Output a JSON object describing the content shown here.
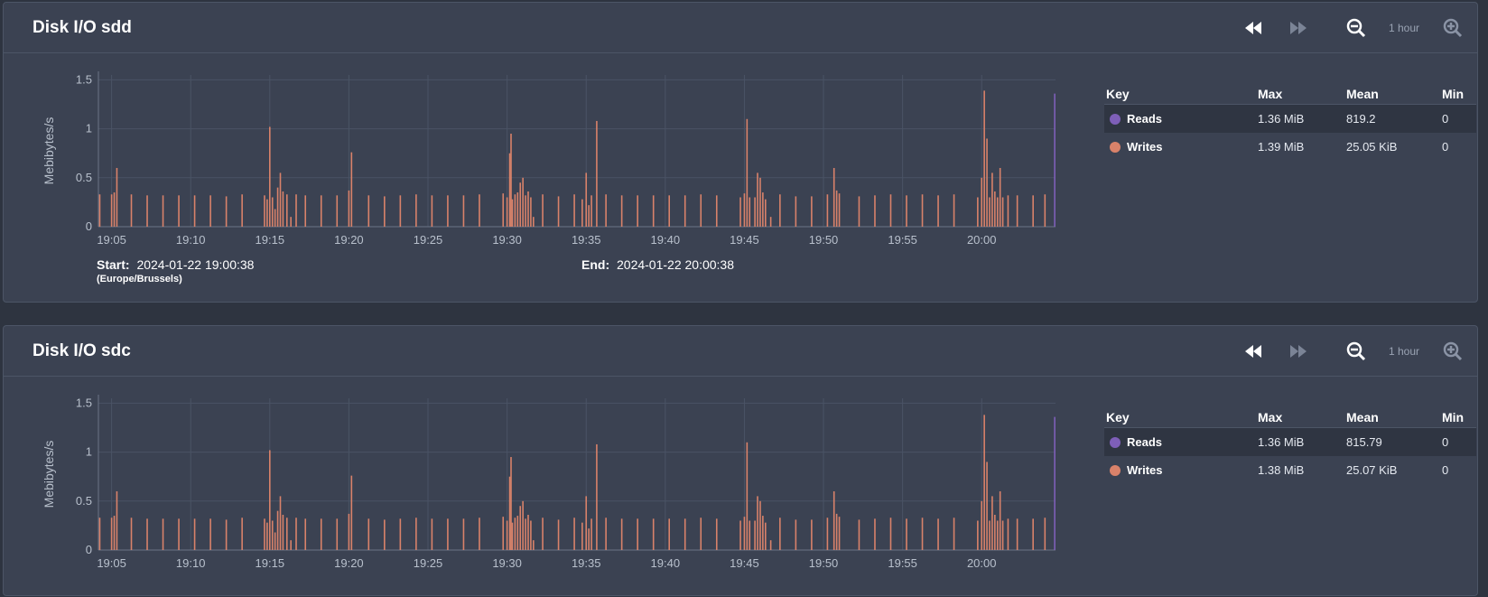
{
  "colors": {
    "reads": "#7e5fb8",
    "writes": "#d9826a"
  },
  "controls": {
    "range_label": "1 hour"
  },
  "panels": [
    {
      "title": "Disk I/O sdd",
      "legend": {
        "headers": {
          "key": "Key",
          "max": "Max",
          "mean": "Mean",
          "min": "Min"
        },
        "rows": [
          {
            "label": "Reads",
            "max": "1.36 MiB",
            "mean": "819.2",
            "min": "0"
          },
          {
            "label": "Writes",
            "max": "1.39 MiB",
            "mean": "25.05 KiB",
            "min": "0"
          }
        ]
      },
      "range": {
        "start_label": "Start:",
        "start_value": "2024-01-22 19:00:38",
        "timezone": "(Europe/Brussels)",
        "end_label": "End:",
        "end_value": "2024-01-22 20:00:38"
      }
    },
    {
      "title": "Disk I/O sdc",
      "legend": {
        "headers": {
          "key": "Key",
          "max": "Max",
          "mean": "Mean",
          "min": "Min"
        },
        "rows": [
          {
            "label": "Reads",
            "max": "1.36 MiB",
            "mean": "815.79",
            "min": "0"
          },
          {
            "label": "Writes",
            "max": "1.38 MiB",
            "mean": "25.07 KiB",
            "min": "0"
          }
        ]
      }
    }
  ],
  "chart_data": [
    {
      "type": "bar",
      "ylabel": "Mebibytes/s",
      "xlim": [
        "19:04:10",
        "20:04:40"
      ],
      "ylim": [
        0,
        1.55
      ],
      "y_ticks": [
        "0",
        "0.5",
        "1",
        "1.5"
      ],
      "x_ticks": [
        "19:05",
        "19:10",
        "19:15",
        "19:20",
        "19:25",
        "19:30",
        "19:35",
        "19:40",
        "19:45",
        "19:50",
        "19:55",
        "20:00"
      ],
      "grid": true,
      "series": [
        {
          "name": "Writes",
          "points": [
            [
              "19:04:15",
              0.33
            ],
            [
              "19:05:00",
              0.33
            ],
            [
              "19:05:10",
              0.35
            ],
            [
              "19:05:20",
              0.6
            ],
            [
              "19:06:15",
              0.33
            ],
            [
              "19:07:15",
              0.32
            ],
            [
              "19:08:15",
              0.32
            ],
            [
              "19:09:15",
              0.32
            ],
            [
              "19:10:15",
              0.32
            ],
            [
              "19:11:15",
              0.32
            ],
            [
              "19:12:15",
              0.31
            ],
            [
              "19:13:15",
              0.33
            ],
            [
              "19:14:40",
              0.32
            ],
            [
              "19:14:50",
              0.28
            ],
            [
              "19:15:00",
              1.02
            ],
            [
              "19:15:10",
              0.3
            ],
            [
              "19:15:20",
              0.18
            ],
            [
              "19:15:30",
              0.4
            ],
            [
              "19:15:40",
              0.55
            ],
            [
              "19:15:50",
              0.36
            ],
            [
              "19:16:05",
              0.33
            ],
            [
              "19:16:20",
              0.1
            ],
            [
              "19:16:40",
              0.33
            ],
            [
              "19:17:15",
              0.32
            ],
            [
              "19:18:15",
              0.32
            ],
            [
              "19:19:15",
              0.32
            ],
            [
              "19:20:00",
              0.37
            ],
            [
              "19:20:10",
              0.76
            ],
            [
              "19:21:15",
              0.32
            ],
            [
              "19:22:15",
              0.31
            ],
            [
              "19:23:15",
              0.32
            ],
            [
              "19:24:15",
              0.33
            ],
            [
              "19:25:15",
              0.32
            ],
            [
              "19:26:15",
              0.32
            ],
            [
              "19:27:15",
              0.32
            ],
            [
              "19:28:15",
              0.33
            ],
            [
              "19:29:45",
              0.34
            ],
            [
              "19:30:00",
              0.3
            ],
            [
              "19:30:10",
              0.75
            ],
            [
              "19:30:15",
              0.95
            ],
            [
              "19:30:20",
              0.28
            ],
            [
              "19:30:30",
              0.33
            ],
            [
              "19:30:40",
              0.35
            ],
            [
              "19:30:50",
              0.45
            ],
            [
              "19:31:00",
              0.5
            ],
            [
              "19:31:10",
              0.32
            ],
            [
              "19:31:20",
              0.36
            ],
            [
              "19:31:30",
              0.3
            ],
            [
              "19:31:40",
              0.1
            ],
            [
              "19:32:15",
              0.33
            ],
            [
              "19:33:15",
              0.31
            ],
            [
              "19:34:15",
              0.33
            ],
            [
              "19:34:45",
              0.28
            ],
            [
              "19:35:00",
              0.55
            ],
            [
              "19:35:10",
              0.22
            ],
            [
              "19:35:20",
              0.32
            ],
            [
              "19:35:40",
              1.08
            ],
            [
              "19:36:15",
              0.33
            ],
            [
              "19:37:15",
              0.32
            ],
            [
              "19:38:15",
              0.32
            ],
            [
              "19:39:15",
              0.32
            ],
            [
              "19:40:15",
              0.32
            ],
            [
              "19:41:15",
              0.32
            ],
            [
              "19:42:15",
              0.33
            ],
            [
              "19:43:15",
              0.32
            ],
            [
              "19:44:45",
              0.3
            ],
            [
              "19:45:00",
              0.34
            ],
            [
              "19:45:10",
              1.1
            ],
            [
              "19:45:20",
              0.3
            ],
            [
              "19:45:40",
              0.3
            ],
            [
              "19:45:50",
              0.55
            ],
            [
              "19:46:00",
              0.5
            ],
            [
              "19:46:10",
              0.35
            ],
            [
              "19:46:20",
              0.28
            ],
            [
              "19:46:40",
              0.1
            ],
            [
              "19:47:15",
              0.33
            ],
            [
              "19:48:15",
              0.31
            ],
            [
              "19:49:15",
              0.31
            ],
            [
              "19:50:15",
              0.33
            ],
            [
              "19:50:40",
              0.6
            ],
            [
              "19:50:50",
              0.37
            ],
            [
              "19:51:00",
              0.34
            ],
            [
              "19:52:15",
              0.31
            ],
            [
              "19:53:15",
              0.32
            ],
            [
              "19:54:15",
              0.33
            ],
            [
              "19:55:15",
              0.32
            ],
            [
              "19:56:15",
              0.33
            ],
            [
              "19:57:15",
              0.32
            ],
            [
              "19:58:15",
              0.33
            ],
            [
              "19:59:45",
              0.3
            ],
            [
              "20:00:00",
              0.5
            ],
            [
              "20:00:10",
              1.39
            ],
            [
              "20:00:20",
              0.9
            ],
            [
              "20:00:30",
              0.3
            ],
            [
              "20:00:40",
              0.55
            ],
            [
              "20:00:50",
              0.36
            ],
            [
              "20:01:00",
              0.3
            ],
            [
              "20:01:10",
              0.6
            ],
            [
              "20:01:20",
              0.3
            ],
            [
              "20:01:40",
              0.32
            ],
            [
              "20:02:15",
              0.32
            ],
            [
              "20:03:15",
              0.32
            ],
            [
              "20:04:00",
              0.33
            ]
          ]
        },
        {
          "name": "Reads",
          "points": [
            [
              "20:04:37",
              1.36
            ]
          ]
        }
      ]
    },
    {
      "type": "bar",
      "ylabel": "Mebibytes/s",
      "xlim": [
        "19:04:10",
        "20:04:40"
      ],
      "ylim": [
        0,
        1.55
      ],
      "y_ticks": [
        "0",
        "0.5",
        "1",
        "1.5"
      ],
      "x_ticks": [
        "19:05",
        "19:10",
        "19:15",
        "19:20",
        "19:25",
        "19:30",
        "19:35",
        "19:40",
        "19:45",
        "19:50",
        "19:55",
        "20:00"
      ],
      "grid": true,
      "series": [
        {
          "name": "Writes",
          "points": [
            [
              "19:04:15",
              0.33
            ],
            [
              "19:05:00",
              0.33
            ],
            [
              "19:05:10",
              0.35
            ],
            [
              "19:05:20",
              0.6
            ],
            [
              "19:06:15",
              0.33
            ],
            [
              "19:07:15",
              0.32
            ],
            [
              "19:08:15",
              0.32
            ],
            [
              "19:09:15",
              0.32
            ],
            [
              "19:10:15",
              0.32
            ],
            [
              "19:11:15",
              0.32
            ],
            [
              "19:12:15",
              0.31
            ],
            [
              "19:13:15",
              0.33
            ],
            [
              "19:14:40",
              0.32
            ],
            [
              "19:14:50",
              0.28
            ],
            [
              "19:15:00",
              1.02
            ],
            [
              "19:15:10",
              0.3
            ],
            [
              "19:15:20",
              0.18
            ],
            [
              "19:15:30",
              0.4
            ],
            [
              "19:15:40",
              0.55
            ],
            [
              "19:15:50",
              0.36
            ],
            [
              "19:16:05",
              0.33
            ],
            [
              "19:16:20",
              0.1
            ],
            [
              "19:16:40",
              0.33
            ],
            [
              "19:17:15",
              0.32
            ],
            [
              "19:18:15",
              0.32
            ],
            [
              "19:19:15",
              0.32
            ],
            [
              "19:20:00",
              0.37
            ],
            [
              "19:20:10",
              0.76
            ],
            [
              "19:21:15",
              0.32
            ],
            [
              "19:22:15",
              0.31
            ],
            [
              "19:23:15",
              0.32
            ],
            [
              "19:24:15",
              0.33
            ],
            [
              "19:25:15",
              0.32
            ],
            [
              "19:26:15",
              0.32
            ],
            [
              "19:27:15",
              0.32
            ],
            [
              "19:28:15",
              0.33
            ],
            [
              "19:29:45",
              0.34
            ],
            [
              "19:30:00",
              0.3
            ],
            [
              "19:30:10",
              0.75
            ],
            [
              "19:30:15",
              0.95
            ],
            [
              "19:30:20",
              0.28
            ],
            [
              "19:30:30",
              0.33
            ],
            [
              "19:30:40",
              0.35
            ],
            [
              "19:30:50",
              0.45
            ],
            [
              "19:31:00",
              0.5
            ],
            [
              "19:31:10",
              0.32
            ],
            [
              "19:31:20",
              0.36
            ],
            [
              "19:31:30",
              0.3
            ],
            [
              "19:31:40",
              0.1
            ],
            [
              "19:32:15",
              0.33
            ],
            [
              "19:33:15",
              0.31
            ],
            [
              "19:34:15",
              0.33
            ],
            [
              "19:34:45",
              0.28
            ],
            [
              "19:35:00",
              0.55
            ],
            [
              "19:35:10",
              0.22
            ],
            [
              "19:35:20",
              0.32
            ],
            [
              "19:35:40",
              1.08
            ],
            [
              "19:36:15",
              0.33
            ],
            [
              "19:37:15",
              0.32
            ],
            [
              "19:38:15",
              0.32
            ],
            [
              "19:39:15",
              0.32
            ],
            [
              "19:40:15",
              0.32
            ],
            [
              "19:41:15",
              0.32
            ],
            [
              "19:42:15",
              0.33
            ],
            [
              "19:43:15",
              0.32
            ],
            [
              "19:44:45",
              0.3
            ],
            [
              "19:45:00",
              0.34
            ],
            [
              "19:45:10",
              1.1
            ],
            [
              "19:45:20",
              0.3
            ],
            [
              "19:45:40",
              0.3
            ],
            [
              "19:45:50",
              0.55
            ],
            [
              "19:46:00",
              0.5
            ],
            [
              "19:46:10",
              0.35
            ],
            [
              "19:46:20",
              0.28
            ],
            [
              "19:46:40",
              0.1
            ],
            [
              "19:47:15",
              0.33
            ],
            [
              "19:48:15",
              0.31
            ],
            [
              "19:49:15",
              0.31
            ],
            [
              "19:50:15",
              0.33
            ],
            [
              "19:50:40",
              0.6
            ],
            [
              "19:50:50",
              0.37
            ],
            [
              "19:51:00",
              0.34
            ],
            [
              "19:52:15",
              0.31
            ],
            [
              "19:53:15",
              0.32
            ],
            [
              "19:54:15",
              0.33
            ],
            [
              "19:55:15",
              0.32
            ],
            [
              "19:56:15",
              0.33
            ],
            [
              "19:57:15",
              0.32
            ],
            [
              "19:58:15",
              0.33
            ],
            [
              "19:59:45",
              0.3
            ],
            [
              "20:00:00",
              0.5
            ],
            [
              "20:00:10",
              1.38
            ],
            [
              "20:00:20",
              0.9
            ],
            [
              "20:00:30",
              0.3
            ],
            [
              "20:00:40",
              0.55
            ],
            [
              "20:00:50",
              0.36
            ],
            [
              "20:01:00",
              0.3
            ],
            [
              "20:01:10",
              0.6
            ],
            [
              "20:01:20",
              0.3
            ],
            [
              "20:01:40",
              0.32
            ],
            [
              "20:02:15",
              0.32
            ],
            [
              "20:03:15",
              0.32
            ],
            [
              "20:04:00",
              0.33
            ]
          ]
        },
        {
          "name": "Reads",
          "points": [
            [
              "20:04:37",
              1.36
            ]
          ]
        }
      ]
    }
  ]
}
